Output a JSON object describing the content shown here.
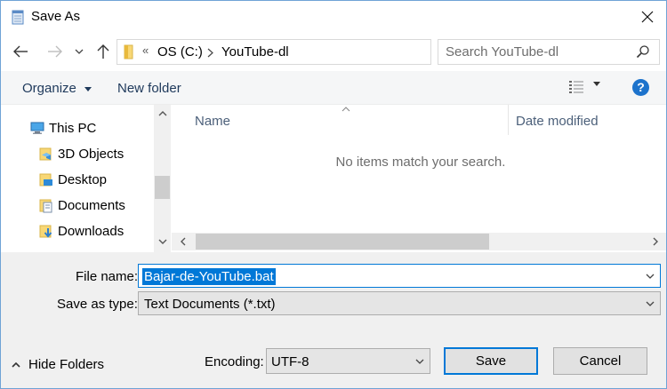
{
  "window": {
    "title": "Save As"
  },
  "address": {
    "overflow": "«",
    "crumbs": [
      "OS (C:)",
      "YouTube-dl"
    ]
  },
  "search": {
    "placeholder": "Search YouTube-dl"
  },
  "toolbar": {
    "organize_label": "Organize",
    "new_folder_label": "New folder",
    "help_label": "?"
  },
  "nav_pane": {
    "items": [
      {
        "label": "This PC",
        "icon": "computer-icon"
      },
      {
        "label": "3D Objects",
        "icon": "3d-objects-folder-icon"
      },
      {
        "label": "Desktop",
        "icon": "desktop-folder-icon"
      },
      {
        "label": "Documents",
        "icon": "documents-folder-icon"
      },
      {
        "label": "Downloads",
        "icon": "downloads-folder-icon"
      }
    ]
  },
  "file_list": {
    "columns": [
      "Name",
      "Date modified"
    ],
    "empty_message": "No items match your search."
  },
  "form": {
    "file_name_label": "File name:",
    "file_name_value": "Bajar-de-YouTube.bat",
    "save_as_type_label": "Save as type:",
    "save_as_type_value": "Text Documents (*.txt)",
    "hide_folders_label": "Hide Folders",
    "encoding_label": "Encoding:",
    "encoding_value": "UTF-8",
    "save_label": "Save",
    "cancel_label": "Cancel"
  },
  "colors": {
    "accent": "#0078d7",
    "help": "#1d73cc",
    "toolbar_text": "#1e395b"
  }
}
